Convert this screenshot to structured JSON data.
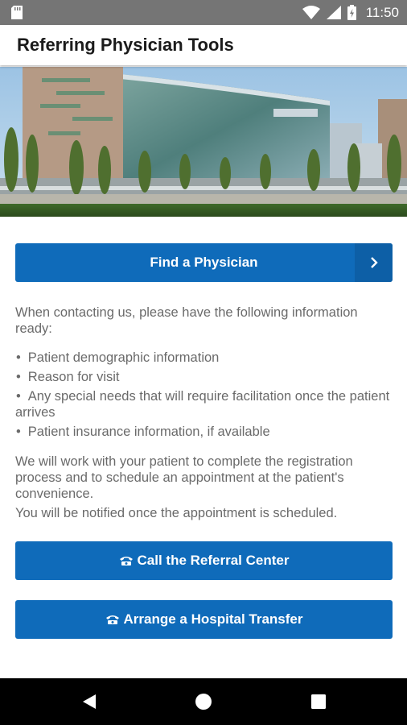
{
  "status_bar": {
    "time": "11:50"
  },
  "app_bar": {
    "title": "Referring Physician Tools"
  },
  "hero": {
    "alt": "hospital-building-photo"
  },
  "find_physician": {
    "label": "Find a Physician"
  },
  "intro": {
    "text": "When contacting us, please have the following information ready:"
  },
  "bullets": [
    {
      "text": "Patient demographic information"
    },
    {
      "text": "Reason for visit"
    },
    {
      "text": "Any special needs that will require facilitation once the patient arrives"
    },
    {
      "text": "Patient insurance information, if available"
    }
  ],
  "registration": {
    "text": "We will work with your patient to complete the registration process and to schedule an appointment at the patient's convenience."
  },
  "notified": {
    "text": "You will be notified once the appointment is scheduled."
  },
  "call_referral": {
    "label": "Call the Referral Center",
    "icon": "phone-icon"
  },
  "hospital_transfer": {
    "label": "Arrange a Hospital Transfer",
    "icon": "phone-icon"
  },
  "colors": {
    "primary_button": "#0f6bba",
    "status_bar": "#757575",
    "nav_bar": "#000000"
  }
}
